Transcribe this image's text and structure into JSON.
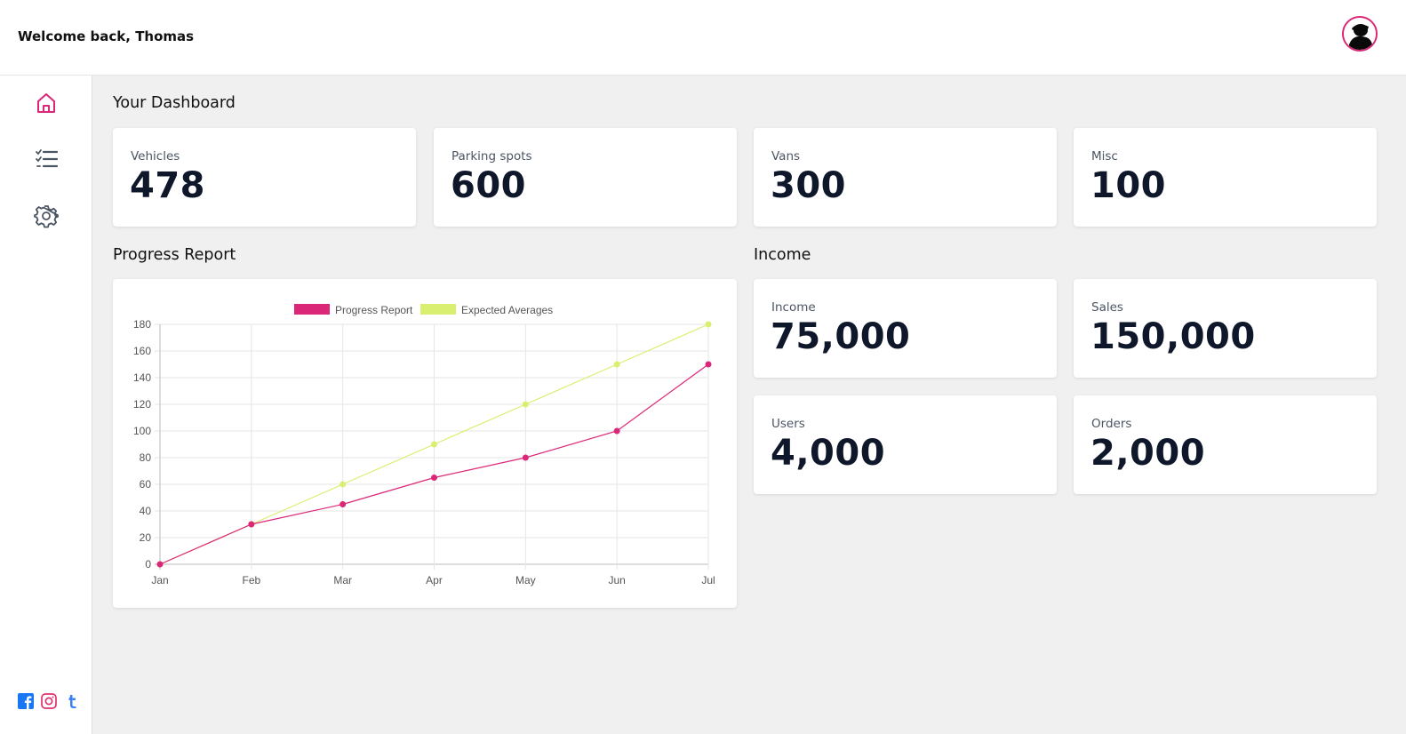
{
  "header": {
    "welcome": "Welcome back, Thomas"
  },
  "sidebar": {
    "items": [
      {
        "name": "home-icon",
        "active": true
      },
      {
        "name": "checklist-icon",
        "active": false
      },
      {
        "name": "gear-icon",
        "active": false
      }
    ],
    "social": [
      "facebook-icon",
      "instagram-icon",
      "tumblr-icon"
    ]
  },
  "dashboard": {
    "title": "Your Dashboard",
    "stats": [
      {
        "label": "Vehicles",
        "value": "478"
      },
      {
        "label": "Parking spots",
        "value": "600"
      },
      {
        "label": "Vans",
        "value": "300"
      },
      {
        "label": "Misc",
        "value": "100"
      }
    ]
  },
  "progress": {
    "title": "Progress Report"
  },
  "income": {
    "title": "Income",
    "stats": [
      {
        "label": "Income",
        "value": "75,000"
      },
      {
        "label": "Sales",
        "value": "150,000"
      },
      {
        "label": "Users",
        "value": "4,000"
      },
      {
        "label": "Orders",
        "value": "2,000"
      }
    ]
  },
  "colors": {
    "accent": "#db2777",
    "expected": "#d9ef6f",
    "icon": "#4b5563",
    "facebook": "#1877f2",
    "instagram": "#e1306c",
    "tumblr": "#3b82f6"
  },
  "chart_data": {
    "type": "line",
    "x": [
      "Jan",
      "Feb",
      "Mar",
      "Apr",
      "May",
      "Jun",
      "Jul"
    ],
    "series": [
      {
        "name": "Progress Report",
        "values": [
          0,
          30,
          45,
          65,
          80,
          100,
          150
        ],
        "color": "#db2777"
      },
      {
        "name": "Expected Averages",
        "values": [
          0,
          30,
          60,
          90,
          120,
          150,
          180
        ],
        "color": "#d9ef6f"
      }
    ],
    "ylim": [
      0,
      180
    ],
    "yticks": [
      0,
      20,
      40,
      60,
      80,
      100,
      120,
      140,
      160,
      180
    ],
    "grid": true,
    "legend": "top"
  }
}
